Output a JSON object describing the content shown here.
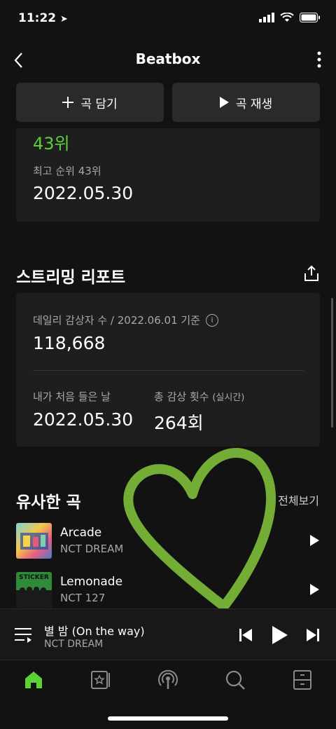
{
  "status_bar": {
    "time": "11:22"
  },
  "header": {
    "title": "Beatbox"
  },
  "actions": {
    "add_label": "곡 담기",
    "play_label": "곡 재생"
  },
  "rank_card": {
    "rank_text": "43위",
    "best_rank_label": "최고 순위 43위",
    "best_rank_date": "2022.05.30"
  },
  "streaming_report": {
    "title": "스트리밍 리포트",
    "daily_listeners_label": "데일리 감상자 수 / 2022.06.01 기준",
    "daily_listeners_value": "118,668",
    "first_listen_label": "내가 처음 들은 날",
    "first_listen_date": "2022.05.30",
    "total_plays_label": "총 감상 횟수",
    "total_plays_sub": "(실시간)",
    "total_plays_value": "264회"
  },
  "similar_songs": {
    "title": "유사한 곡",
    "view_all": "전체보기",
    "items": [
      {
        "title": "Arcade",
        "artist": "NCT DREAM"
      },
      {
        "title": "Lemonade",
        "artist": "NCT 127",
        "thumb_text": "STICKER"
      }
    ]
  },
  "mini_player": {
    "title": "별 밤 (On the way)",
    "artist": "NCT DREAM"
  },
  "colors": {
    "accent": "#5ed134",
    "background": "#121212",
    "card": "#1e1e1e",
    "heart_overlay": "#7fbf3a"
  },
  "bottom_nav": [
    "home-icon",
    "library-icon",
    "podcast-icon",
    "search-icon",
    "storage-icon"
  ]
}
